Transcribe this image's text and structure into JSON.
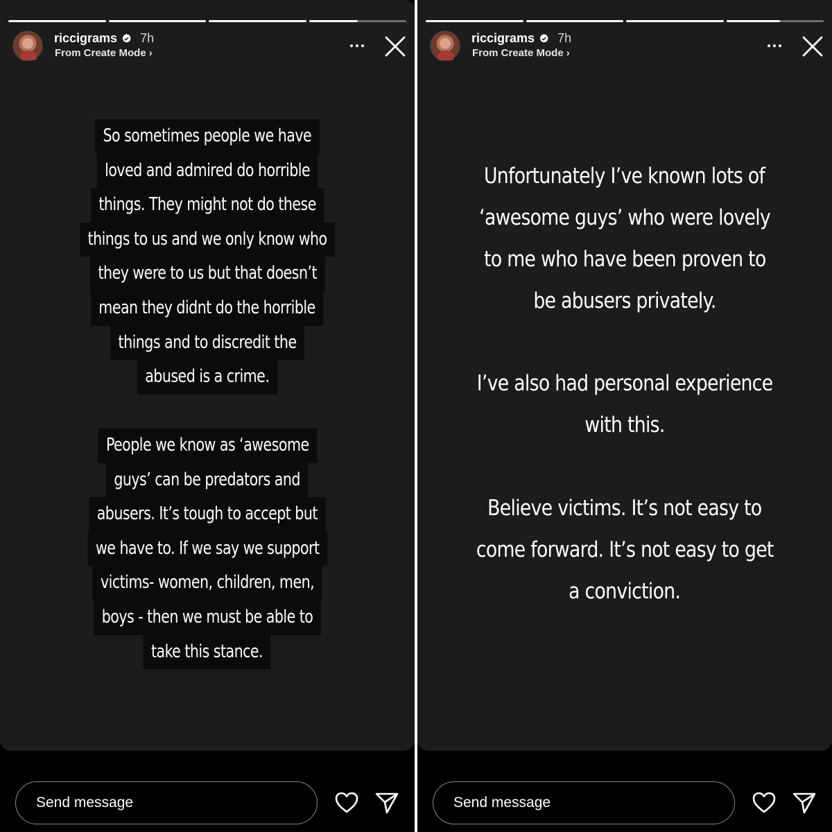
{
  "stories": [
    {
      "id": "left",
      "username": "riccigrams",
      "time": "7h",
      "subtitle": "From Create Mode",
      "progress": [
        1,
        1,
        1,
        0.5
      ],
      "highlighted_paragraphs": [
        [
          "So sometimes people we have",
          "loved and admired do horrible",
          "things. They might not do these",
          "things to us and we only know who",
          "they were to us but that doesn’t",
          "mean they didnt do the horrible",
          "things and to discredit the",
          "abused is a crime."
        ],
        [
          "People we know as ‘awesome",
          "guys’ can be predators and",
          "abusers. It’s tough to accept but",
          "we have to. If we say we support",
          "victims- women, children, men,",
          "boys - then  we must be able to",
          "take this stance."
        ]
      ],
      "message_placeholder": "Send message"
    },
    {
      "id": "right",
      "username": "riccigrams",
      "time": "7h",
      "subtitle": "From Create Mode",
      "progress": [
        1,
        1,
        1,
        0.55
      ],
      "plain_paragraphs": [
        [
          "Unfortunately I’ve known lots of",
          "‘awesome guys’ who were lovely",
          "to me who have been proven to",
          "be abusers privately."
        ],
        [
          "I’ve also had personal experience",
          "with this."
        ],
        [
          "Believe victims. It’s not easy to",
          "come forward. It’s not easy to get",
          "a conviction."
        ]
      ],
      "message_placeholder": "Send message"
    }
  ],
  "icons": {
    "verified": "verified-badge-icon",
    "more": "more-options-icon",
    "close": "close-icon",
    "like": "heart-icon",
    "share": "paper-plane-icon"
  },
  "colors": {
    "story_background": "#1c1c1c",
    "highlight_box": "#0b0b0b",
    "text": "#ffffff"
  }
}
